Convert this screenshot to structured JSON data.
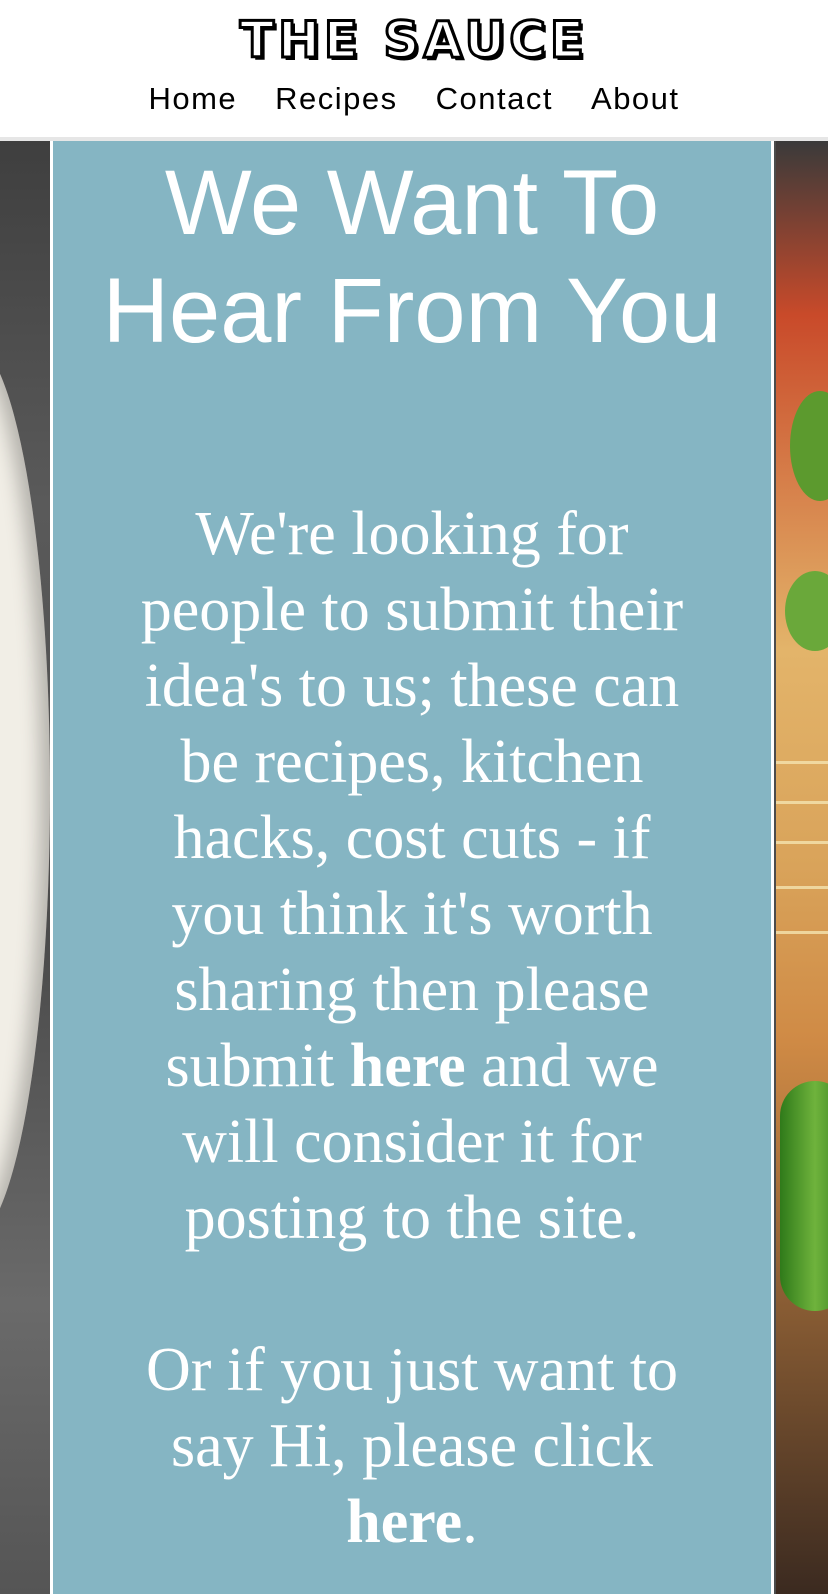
{
  "header": {
    "logo": "THE SAUCE",
    "nav": [
      "Home",
      "Recipes",
      "Contact",
      "About"
    ]
  },
  "main": {
    "headline": "We Want To Hear From You",
    "paragraph1_before": "We're looking for people to submit their idea's to us; these can be recipes, kitchen hacks, cost cuts - if you think it's worth sharing then please submit ",
    "link1": "here",
    "paragraph1_after": " and we will consider it for posting to the site.",
    "paragraph2_before": "Or if you just want to say Hi, please click ",
    "link2": "here",
    "paragraph2_after": "."
  },
  "colors": {
    "panel": "#85b5c3",
    "text": "#ffffff",
    "nav_text": "#000000"
  }
}
